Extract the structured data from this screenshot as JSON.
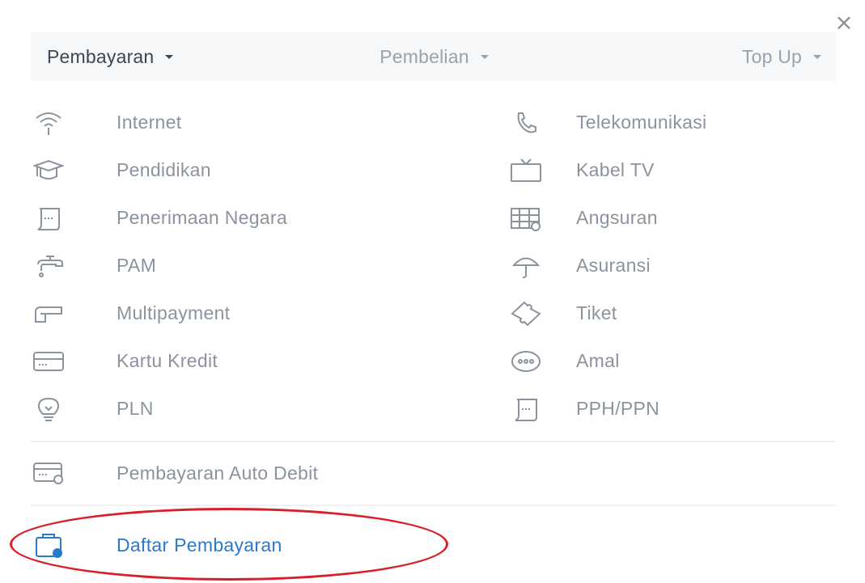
{
  "close_label": "×",
  "tabs": [
    {
      "label": "Pembayaran",
      "active": true
    },
    {
      "label": "Pembelian",
      "active": false
    },
    {
      "label": "Top Up",
      "active": false
    }
  ],
  "left_items": [
    {
      "label": "Internet",
      "icon": "wifi-icon"
    },
    {
      "label": "Pendidikan",
      "icon": "graduation-cap-icon"
    },
    {
      "label": "Penerimaan Negara",
      "icon": "document-icon"
    },
    {
      "label": "PAM",
      "icon": "faucet-icon"
    },
    {
      "label": "Multipayment",
      "icon": "hand-payment-icon"
    },
    {
      "label": "Kartu Kredit",
      "icon": "credit-card-icon"
    },
    {
      "label": "PLN",
      "icon": "lightbulb-icon"
    }
  ],
  "right_items": [
    {
      "label": "Telekomunikasi",
      "icon": "phone-icon"
    },
    {
      "label": "Kabel TV",
      "icon": "tv-icon"
    },
    {
      "label": "Angsuran",
      "icon": "calendar-icon"
    },
    {
      "label": "Asuransi",
      "icon": "umbrella-icon"
    },
    {
      "label": "Tiket",
      "icon": "ticket-icon"
    },
    {
      "label": "Amal",
      "icon": "donation-icon"
    },
    {
      "label": "PPH/PPN",
      "icon": "document-icon"
    }
  ],
  "auto_debit": {
    "label": "Pembayaran Auto Debit",
    "icon": "card-gear-icon"
  },
  "daftar": {
    "label": "Daftar Pembayaran",
    "icon": "list-bag-icon"
  },
  "colors": {
    "text_muted": "#8b939e",
    "active_tab": "#3d4654",
    "link": "#2b79c9",
    "highlight": "#d8202c"
  }
}
